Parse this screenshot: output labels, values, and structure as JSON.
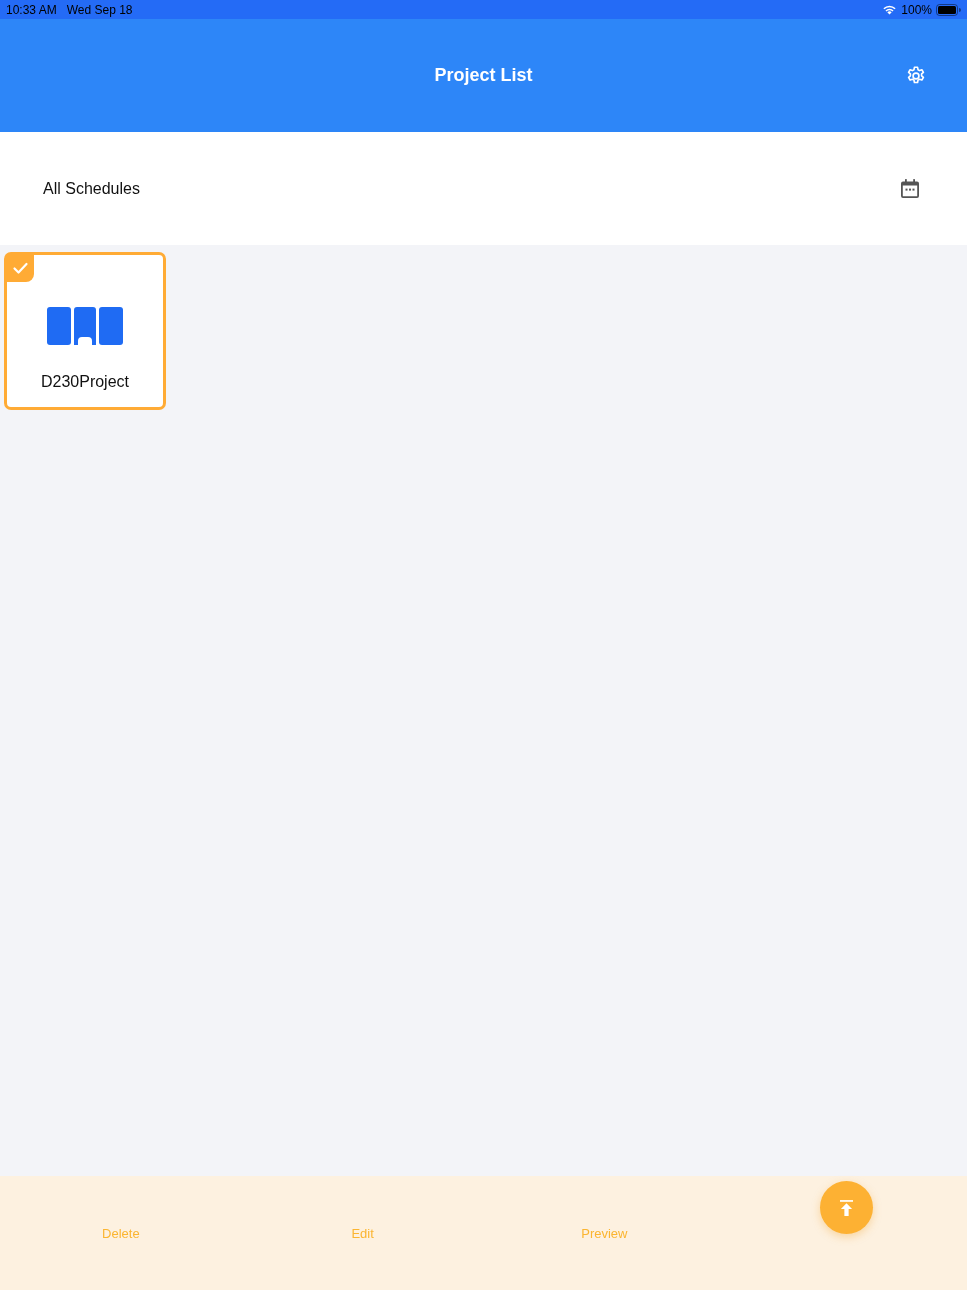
{
  "status_bar": {
    "time": "10:33 AM",
    "date": "Wed Sep 18",
    "battery": "100%"
  },
  "header": {
    "title": "Project List"
  },
  "filter": {
    "label": "All Schedules"
  },
  "projects": [
    {
      "name": "D230Project",
      "selected": true
    }
  ],
  "toolbar": {
    "buttons": [
      "Delete",
      "Edit",
      "Preview"
    ]
  }
}
